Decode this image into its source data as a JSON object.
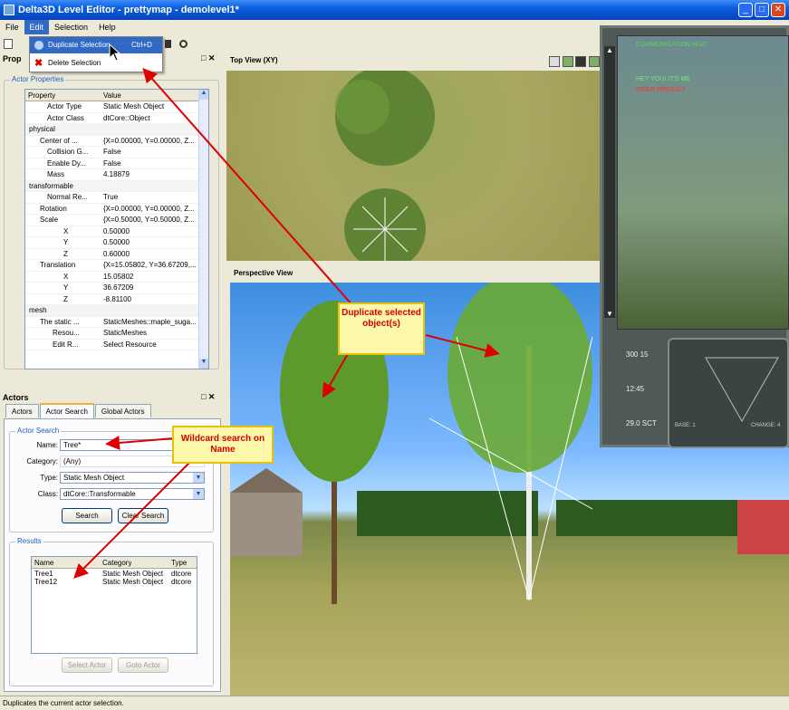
{
  "window": {
    "title": "Delta3D Level Editor - prettymap - demolevel1*"
  },
  "menu": {
    "items": [
      "File",
      "Edit",
      "Selection",
      "Help"
    ]
  },
  "edit_menu": {
    "duplicate_label": "Duplicate Selection",
    "duplicate_shortcut": "Ctrl+D",
    "delete_label": "Delete Selection"
  },
  "properties_panel": {
    "title": "Prop",
    "group_label": "Actor Properties",
    "col_property": "Property",
    "col_value": "Value",
    "rows": [
      {
        "name": "Actor Type",
        "value": "Static Mesh Object"
      },
      {
        "name": "Actor Class",
        "value": "dtCore::Object"
      },
      {
        "name": "physical",
        "value": ""
      },
      {
        "name": "Center of ...",
        "value": "{X=0.00000, Y=0.00000, Z..."
      },
      {
        "name": "Collision G...",
        "value": "False"
      },
      {
        "name": "Enable Dy...",
        "value": "False"
      },
      {
        "name": "Mass",
        "value": "4.18879"
      },
      {
        "name": "transformable",
        "value": ""
      },
      {
        "name": "Normal Re...",
        "value": "True"
      },
      {
        "name": "Rotation",
        "value": "{X=0.00000, Y=0.00000, Z..."
      },
      {
        "name": "Scale",
        "value": "{X=0.50000, Y=0.50000, Z..."
      },
      {
        "name": "X",
        "value": "0.50000"
      },
      {
        "name": "Y",
        "value": "0.50000"
      },
      {
        "name": "Z",
        "value": "0.60000"
      },
      {
        "name": "Translation",
        "value": "{X=15.05802, Y=36.67209,..."
      },
      {
        "name": "X",
        "value": "15.05802"
      },
      {
        "name": "Y",
        "value": "36.67209"
      },
      {
        "name": "Z",
        "value": "-8.81100"
      },
      {
        "name": "mesh",
        "value": ""
      },
      {
        "name": "The static ...",
        "value": "StaticMeshes::maple_suga..."
      },
      {
        "name": "Resou...",
        "value": "StaticMeshes"
      },
      {
        "name": "Edit R...",
        "value": "Select Resource"
      }
    ]
  },
  "actors_panel": {
    "title": "Actors",
    "tabs": [
      "Actors",
      "Actor Search",
      "Global Actors"
    ],
    "search_group": "Actor Search",
    "name_label": "Name:",
    "name_value": "Tree*",
    "category_label": "Category:",
    "category_value": "(Any)",
    "type_label": "Type:",
    "type_value": "Static Mesh Object",
    "class_label": "Class:",
    "class_value": "dtCore::Transformable",
    "search_btn": "Search",
    "clear_btn": "Clear Search",
    "results_group": "Results",
    "results_cols": [
      "Name",
      "Category",
      "Type"
    ],
    "results": [
      {
        "name": "Tree1",
        "category": "Static Mesh Object",
        "type": "dtcore"
      },
      {
        "name": "Tree12",
        "category": "Static Mesh Object",
        "type": "dtcore"
      }
    ],
    "select_btn": "Select Actor",
    "goto_btn": "Goto Actor"
  },
  "views": {
    "top": "Top View (XY)",
    "perspective": "Perspective View"
  },
  "callouts": {
    "duplicate": "Duplicate selected object(s)",
    "wildcard": "Wildcard search on Name"
  },
  "hud": {
    "comm": "COMMUNICATION HIST",
    "msg1": "HEY YOU! IT'S ME",
    "msg2": "TIGER PRESSLY",
    "r1": "300 15",
    "r2": "12:45",
    "r3": "29.0 SCT",
    "base": "BASE: 1",
    "change": "CHANGE: 4"
  },
  "status": "Duplicates the current actor selection."
}
